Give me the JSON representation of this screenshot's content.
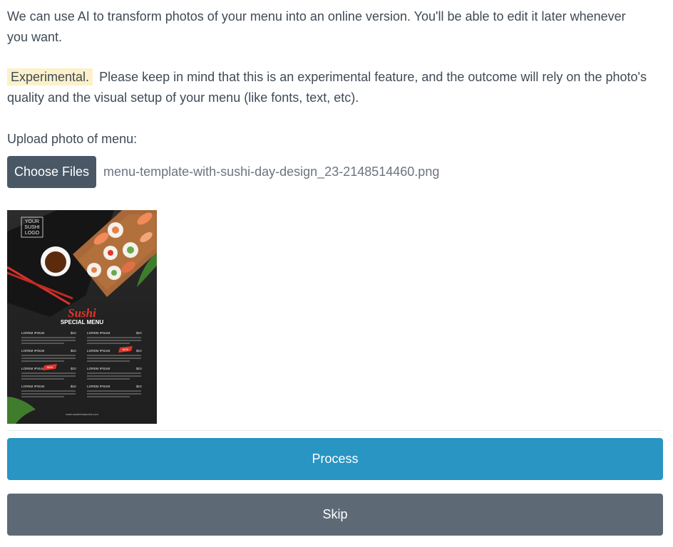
{
  "intro_text": "We can use AI to transform photos of your menu into an online version. You'll be able to edit it later whenever you want.",
  "experimental": {
    "badge": "Experimental.",
    "text": "Please keep in mind that this is an experimental feature, and the outcome will rely on the photo's quality and the visual setup of your menu (like fonts, text, etc)."
  },
  "upload": {
    "label": "Upload photo of menu:",
    "button_label": "Choose Files",
    "file_name": "menu-template-with-sushi-day-design_23-2148514460.png"
  },
  "preview_menu": {
    "logo_lines": [
      "YOUR",
      "SUSHI",
      "LOGO"
    ],
    "title": "Sushi",
    "subtitle": "SPECIAL MENU",
    "items": [
      {
        "name": "LOREM IPSUM",
        "price": "$10"
      },
      {
        "name": "LOREM IPSUM",
        "price": "$10"
      },
      {
        "name": "LOREM IPSUM",
        "price": "$10"
      },
      {
        "name": "LOREM IPSUM",
        "price": "$10"
      },
      {
        "name": "LOREM IPSUM",
        "price": "$10"
      },
      {
        "name": "LOREM IPSUM",
        "price": "$10"
      },
      {
        "name": "LOREM IPSUM",
        "price": "$10"
      },
      {
        "name": "LOREM IPSUM",
        "price": "$10"
      }
    ],
    "badge_new": "NEW",
    "website": "www.sushirestaurant.com"
  },
  "actions": {
    "process_label": "Process",
    "skip_label": "Skip"
  },
  "colors": {
    "process": "#2895c3",
    "skip": "#5d6a76",
    "choose_button": "#4a5866",
    "badge_bg": "#fdf1c9",
    "accent_red": "#e2342b"
  }
}
